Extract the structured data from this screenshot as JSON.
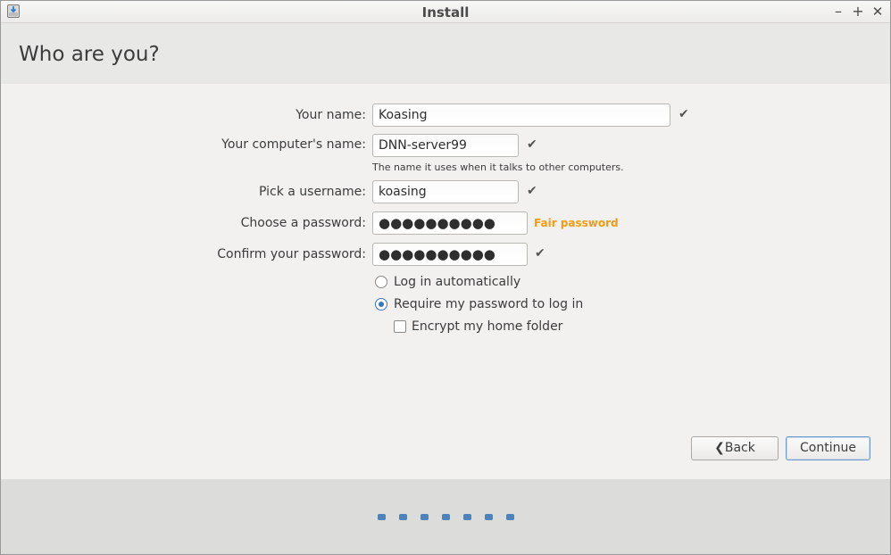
{
  "window": {
    "title": "Install"
  },
  "page": {
    "title": "Who are you?"
  },
  "form": {
    "name_label": "Your name:",
    "name_value": "Koasing",
    "computer_label": "Your computer's name:",
    "computer_value": "DNN-server99",
    "computer_hint": "The name it uses when it talks to other computers.",
    "username_label": "Pick a username:",
    "username_value": "koasing",
    "password_label": "Choose a password:",
    "password_value": "●●●●●●●●●●",
    "password_strength": "Fair password",
    "confirm_label": "Confirm your password:",
    "confirm_value": "●●●●●●●●●●",
    "check_glyph": "✔"
  },
  "options": {
    "auto_login": "Log in automatically",
    "require_password": "Require my password to log in",
    "encrypt_home": "Encrypt my home folder",
    "selected": "require_password",
    "encrypt_checked": false
  },
  "buttons": {
    "back": "Back",
    "continue": "Continue"
  },
  "progress": {
    "total_steps": 7
  },
  "colors": {
    "accent": "#4a83bd",
    "strength": "#f39c12"
  },
  "icons": {
    "app": "installer-icon",
    "back": "chevron-left-icon"
  }
}
